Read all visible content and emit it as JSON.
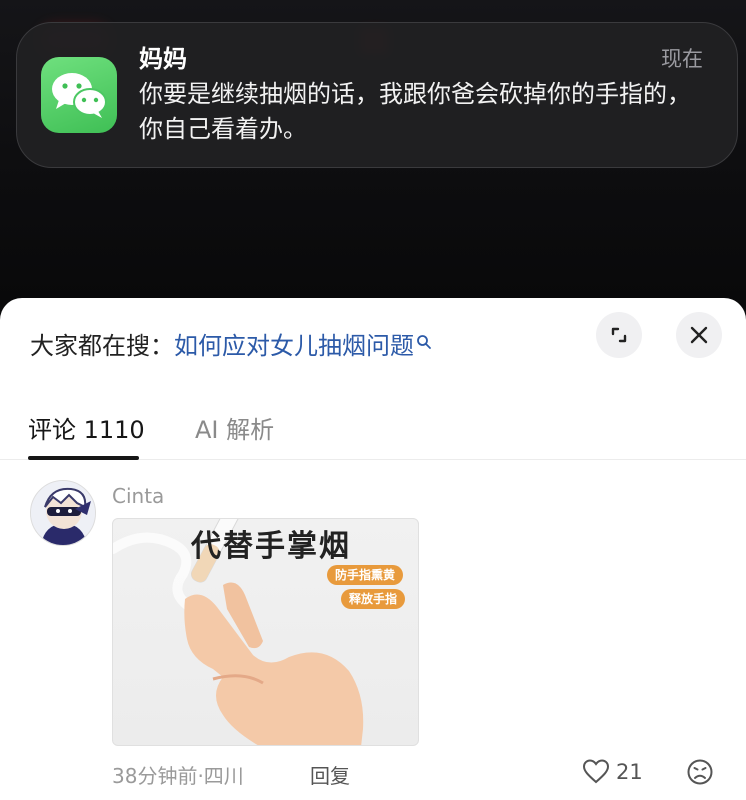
{
  "notification": {
    "app_icon": "wechat-icon",
    "sender": "妈妈",
    "time": "现在",
    "message": "你要是继续抽烟的话，我跟你爸会砍掉你的手指的，你自己看着办。"
  },
  "panel": {
    "search_prefix": "大家都在搜：",
    "search_query": "如何应对女儿抽烟问题",
    "tabs": [
      {
        "label": "评论 1110",
        "active": true
      },
      {
        "label": "AI 解析",
        "active": false
      }
    ]
  },
  "comment": {
    "username": "Cinta",
    "image": {
      "title": "代替手掌烟",
      "tags": [
        "防手指熏黄",
        "释放手指"
      ]
    },
    "time_location": "38分钟前·四川",
    "reply_label": "回复",
    "like_count": "21"
  },
  "colors": {
    "link": "#2c5aa8",
    "wechat_green": "#3fbf55",
    "tag_orange": "#e89a3c"
  }
}
